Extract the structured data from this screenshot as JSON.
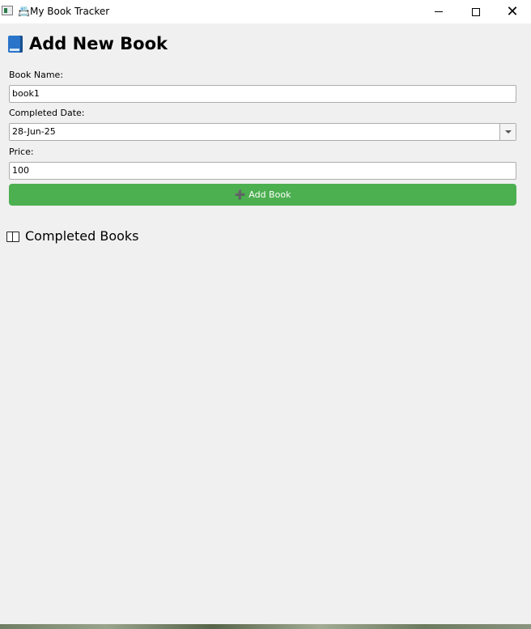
{
  "window": {
    "title_emoji": "📇",
    "title": "My Book Tracker",
    "controls": {
      "minimize": "minimize",
      "maximize": "maximize",
      "close": "✕"
    }
  },
  "form": {
    "heading": "Add New Book",
    "heading_icon": "blue-book-icon",
    "book_name_label": "Book Name:",
    "book_name_value": "book1",
    "completed_date_label": "Completed Date:",
    "completed_date_value": "28-Jun-25",
    "price_label": "Price:",
    "price_value": "100",
    "add_button_icon": "➕",
    "add_button_label": "Add Book",
    "add_button_color": "#4caf50"
  },
  "completed": {
    "heading_icon": "open-book-icon",
    "heading": "Completed Books"
  }
}
